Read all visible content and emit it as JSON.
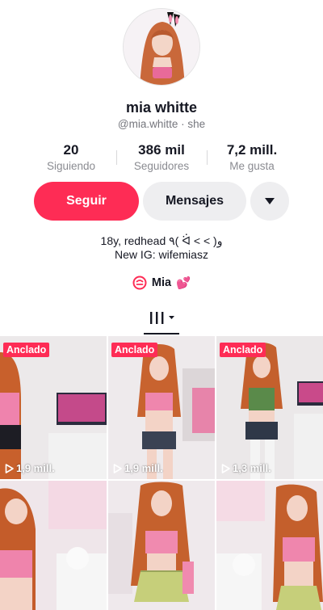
{
  "profile": {
    "name": "mia whitte",
    "handle": "@mia.whitte · she"
  },
  "stats": [
    {
      "value": "20",
      "label": "Siguiendo"
    },
    {
      "value": "386 mil",
      "label": "Seguidores"
    },
    {
      "value": "7,2 mill.",
      "label": "Me gusta"
    }
  ],
  "actions": {
    "follow_label": "Seguir",
    "message_label": "Mensajes",
    "more_icon": "caret-down-icon"
  },
  "bio": {
    "line1": "18y, redhead ٩( ᐛ ˂ ˂ )و",
    "line2": "New IG: wifemiasz"
  },
  "group": {
    "icon": "group-chat-icon",
    "label": "Mia",
    "emoji": "💕"
  },
  "tabs": {
    "active": "videos-grid-icon"
  },
  "videos": [
    {
      "pinned": true,
      "pin_label": "Anclado",
      "views": "1,9 mill."
    },
    {
      "pinned": true,
      "pin_label": "Anclado",
      "views": "1,9 mill."
    },
    {
      "pinned": true,
      "pin_label": "Anclado",
      "views": "1,3 mill."
    },
    {
      "pinned": false,
      "pin_label": "",
      "views": ""
    },
    {
      "pinned": false,
      "pin_label": "",
      "views": ""
    },
    {
      "pinned": false,
      "pin_label": "",
      "views": ""
    }
  ],
  "colors": {
    "accent": "#fe2c55",
    "secondary_bg": "#eeeef0",
    "text": "#161823",
    "muted": "#8a8b91"
  }
}
